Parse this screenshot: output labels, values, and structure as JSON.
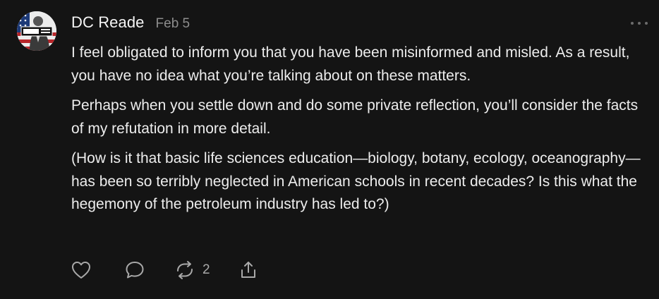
{
  "comment": {
    "author": "DC Reade",
    "date": "Feb 5",
    "avatar": {
      "badge_text": "THE IMAGE",
      "colors": [
        "#b8262a",
        "#1d3a78",
        "#ffffff"
      ]
    },
    "paragraphs": [
      "I feel obligated to inform you that you have been misinformed and misled. As a result, you have no idea what you’re talking about on these matters.",
      "Perhaps when you settle down and do some private reflection, you’ll consider the facts of my refutation in more detail.",
      "(How is it that basic life sciences education—biology, botany, ecology, oceanography— has been so terribly neglected in American schools in recent decades? Is this what the hegemony of the petroleum industry has led to?)"
    ],
    "actions": {
      "like_icon": "heart-icon",
      "reply_icon": "speech-bubble-icon",
      "restack_icon": "restack-arrows-icon",
      "restack_count": "2",
      "share_icon": "share-icon"
    },
    "more_icon": "ellipsis-icon"
  },
  "theme": {
    "background": "#141414",
    "text": "#ededed",
    "muted": "#8d8d8d",
    "icon": "#a9a9a9"
  }
}
